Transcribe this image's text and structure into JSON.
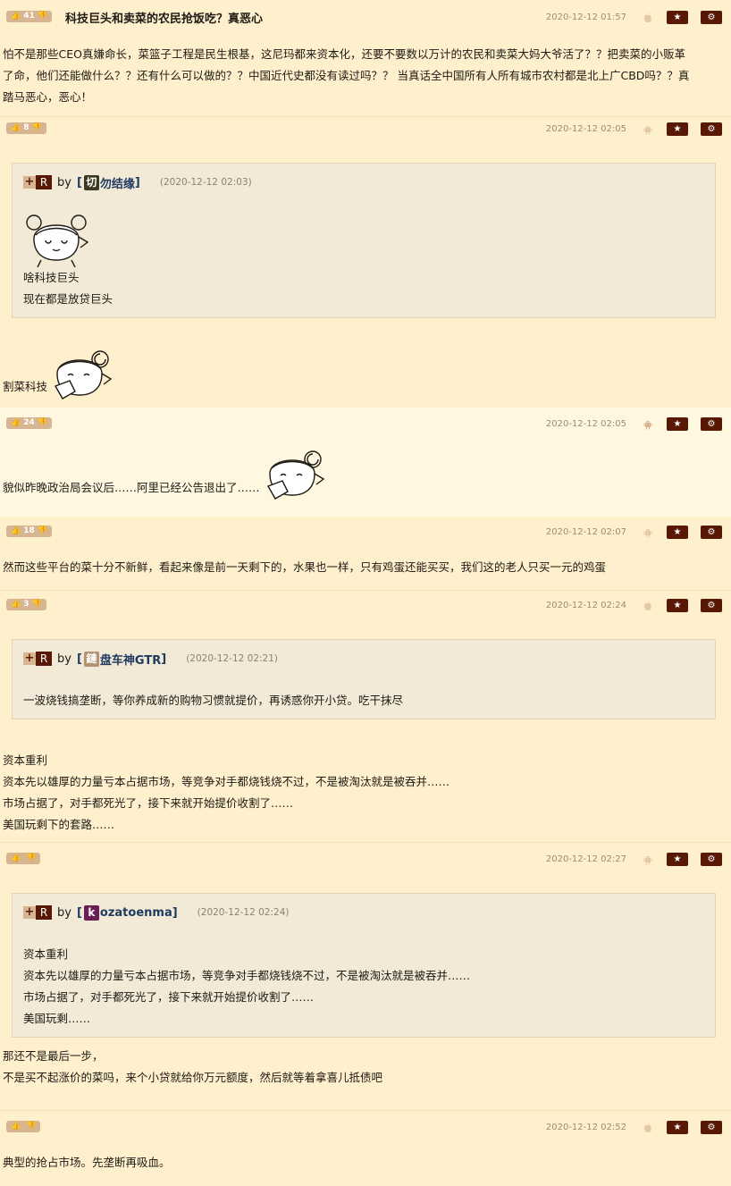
{
  "icons": {
    "thumb_up": "thumbs-up-icon",
    "thumb_down": "thumbs-down-icon",
    "star": "star-icon",
    "gear": "gear-icon",
    "apple": "apple-icon",
    "android": "android-icon"
  },
  "colors": {
    "page_bg": "#fff0cd",
    "alt_bg": "#fff7e0",
    "vote_badge": "#d7b590",
    "action_button": "#591804",
    "quote_bg": "#f2e9d6",
    "author": "#1e3a5f"
  },
  "post1": {
    "votes": "41",
    "title": "科技巨头和卖菜的农民抢饭吃？真恶心",
    "date": "2020-12-12 01:57",
    "lines": [
      "怕不是那些CEO真嫌命长，菜篮子工程是民生根基，这尼玛都来资本化，还要不要数以万计的农民和卖菜大妈大爷活了？？把卖菜的小贩革",
      "了命，他们还能做什么？？还有什么可以做的？？中国近代史都没有读过吗？？ 当真话全中国所有人所有城市农村都是北上广CBD吗？？真",
      "踏马恶心，恶心！"
    ]
  },
  "post2": {
    "votes": "8",
    "date": "2020-12-12 02:05",
    "quote": {
      "plus": "+",
      "r": "R",
      "by": "by",
      "bracket_open": "[",
      "avatar": "切",
      "author": "勿结缘",
      "bracket_close": "]",
      "date": "(2020-12-12 02:03)",
      "lines": [
        "啥科技巨头",
        "现在都是放贷巨头"
      ]
    },
    "text": "割菜科技"
  },
  "post3": {
    "votes": "24",
    "date": "2020-12-12 02:05",
    "text": "貌似昨晚政治局会议后……阿里已经公告退出了……"
  },
  "post4": {
    "votes": "18",
    "date": "2020-12-12 02:07",
    "text": "然而这些平台的菜十分不新鲜，看起来像是前一天剩下的，水果也一样，只有鸡蛋还能买买，我们这的老人只买一元的鸡蛋"
  },
  "post5": {
    "votes": "3",
    "date": "2020-12-12 02:24",
    "quote": {
      "plus": "+",
      "r": "R",
      "by": "by",
      "bracket_open": "[",
      "avatar": "鏈",
      "author": "盘车神GTR",
      "bracket_close": "]",
      "date": "(2020-12-12 02:21)",
      "lines": [
        "一波烧钱搞垄断，等你养成新的购物习惯就提价，再诱惑你开小贷。吃干抹尽"
      ]
    },
    "lines": [
      "资本重利",
      "资本先以雄厚的力量亏本占据市场，等竞争对手都烧钱烧不过，不是被淘汰就是被吞并……",
      "市场占据了，对手都死光了，接下来就开始提价收割了……",
      "美国玩剩下的套路……"
    ]
  },
  "post6": {
    "votes": "",
    "date": "2020-12-12 02:27",
    "quote": {
      "plus": "+",
      "r": "R",
      "by": "by",
      "bracket_open": "[",
      "avatar": "k",
      "author": "ozatoenma",
      "bracket_close": "]",
      "date": "(2020-12-12 02:24)",
      "lines": [
        "资本重利",
        "资本先以雄厚的力量亏本占据市场，等竞争对手都烧钱烧不过，不是被淘汰就是被吞并……",
        "市场占据了，对手都死光了，接下来就开始提价收割了……",
        "美国玩剩……"
      ]
    },
    "lines": [
      "那还不是最后一步，",
      "不是买不起涨价的菜吗，来个小贷就给你万元额度，然后就等着拿喜儿抵债吧"
    ]
  },
  "post7": {
    "votes": "",
    "date": "2020-12-12 02:52",
    "text": "典型的抢占市场。先垄断再吸血。"
  }
}
